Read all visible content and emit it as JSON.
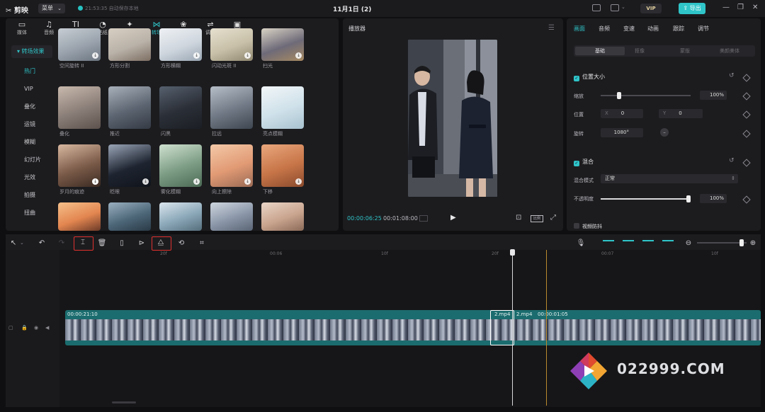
{
  "titlebar": {
    "app_name": "剪映",
    "menu_label": "菜单",
    "autosave_status": "21:53:35 自动保存本地",
    "project_title": "11月1日 (2)",
    "vip_label": "VIP",
    "export_label": "导出"
  },
  "media_tabs": [
    {
      "label": "媒体",
      "icon": "▭"
    },
    {
      "label": "音频",
      "icon": "♫"
    },
    {
      "label": "文本",
      "icon": "TI"
    },
    {
      "label": "贴纸",
      "icon": "◔"
    },
    {
      "label": "特效",
      "icon": "✦"
    },
    {
      "label": "转场",
      "icon": "⋈"
    },
    {
      "label": "滤镜",
      "icon": "❀"
    },
    {
      "label": "调节",
      "icon": "⇌"
    },
    {
      "label": "素材包",
      "icon": "▣"
    }
  ],
  "subnav": {
    "header": "▾ 转场效果",
    "items": [
      "热门",
      "VIP",
      "叠化",
      "运镜",
      "模糊",
      "幻灯片",
      "光效",
      "拍摄",
      "扭曲"
    ]
  },
  "thumbnails": {
    "row1": [
      "空间旋转 II",
      "方形分割",
      "方形横糊",
      "闪动光斑 II",
      "扫光"
    ],
    "row2": [
      "叠化",
      "推近",
      "闪黑",
      "拉远",
      "亮点模糊"
    ],
    "row3": [
      "岁月的痕迹",
      "眨眼",
      "雾化模糊",
      "向上擦除",
      "下移"
    ],
    "row4": [
      "",
      "",
      "",
      "",
      ""
    ]
  },
  "player": {
    "title": "播放器",
    "current_time": "00:00:06:25",
    "total_time": "00:01:08:00",
    "ratio_label": "比例"
  },
  "props": {
    "tabs": [
      "画面",
      "音频",
      "变速",
      "动画",
      "跟踪",
      "调节"
    ],
    "subtabs": [
      "基础",
      "抠像",
      "蒙版",
      "美颜美体"
    ],
    "position_size": {
      "title": "位置大小",
      "scale_label": "缩放",
      "scale_value": "100%",
      "scale_level": 0.18,
      "position_label": "位置",
      "x_label": "X",
      "x_value": "0",
      "y_label": "Y",
      "y_value": "0",
      "rotate_label": "旋转",
      "rotate_value": "1080°"
    },
    "blend": {
      "title": "混合",
      "mode_label": "混合模式",
      "mode_value": "正常",
      "opacity_label": "不透明度",
      "opacity_value": "100%",
      "opacity_level": 1.0
    },
    "stabilize_label": "视频防抖"
  },
  "timeline": {
    "ruler_labels": [
      "20f",
      "00:06",
      "10f",
      "20f",
      "00:07",
      "10f"
    ],
    "clip_time_left": "00:00:21:10",
    "clip_name_1": "2.mp4",
    "clip_name_2": "2.mp4",
    "clip_time_right": "00:00:01:05",
    "zoom_level": 0.9
  },
  "watermark": {
    "text": "022999.COM"
  }
}
